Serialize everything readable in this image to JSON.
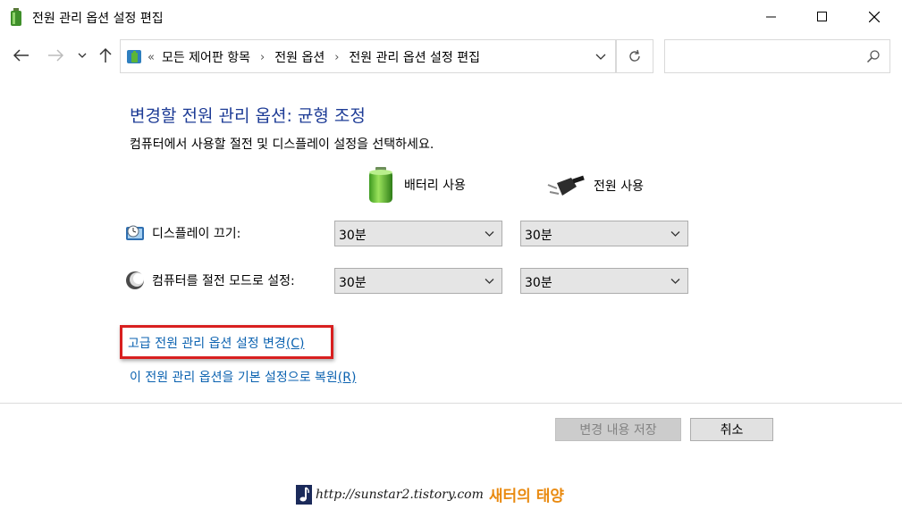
{
  "window": {
    "title": "전원 관리 옵션 설정 편집"
  },
  "address": {
    "lead": "«",
    "crumbs": [
      "모든 제어판 항목",
      "전원 옵션",
      "전원 관리 옵션 설정 편집"
    ],
    "search_placeholder": ""
  },
  "content": {
    "heading": "변경할 전원 관리 옵션: 균형 조정",
    "subtext": "컴퓨터에서 사용할 절전 및 디스플레이 설정을 선택하세요.",
    "col_battery": "배터리 사용",
    "col_power": "전원 사용",
    "rows": [
      {
        "label": "디스플레이 끄기:",
        "battery": "30분",
        "plugged": "30분"
      },
      {
        "label": "컴퓨터를 절전 모드로 설정:",
        "battery": "30분",
        "plugged": "30분"
      }
    ],
    "link_advanced": "고급 전원 관리 옵션 설정 변경",
    "link_advanced_key": "(C)",
    "link_restore": "이 전원 관리 옵션을 기본 설정으로 복원",
    "link_restore_key": "(R)"
  },
  "buttons": {
    "save": "변경 내용 저장",
    "cancel": "취소"
  },
  "watermark": {
    "url": "http://sunstar2.tistory.com",
    "name": "새터의 태양"
  },
  "colors": {
    "heading": "#1e3c96",
    "link": "#0b62b0",
    "highlight": "#d81f1f"
  }
}
